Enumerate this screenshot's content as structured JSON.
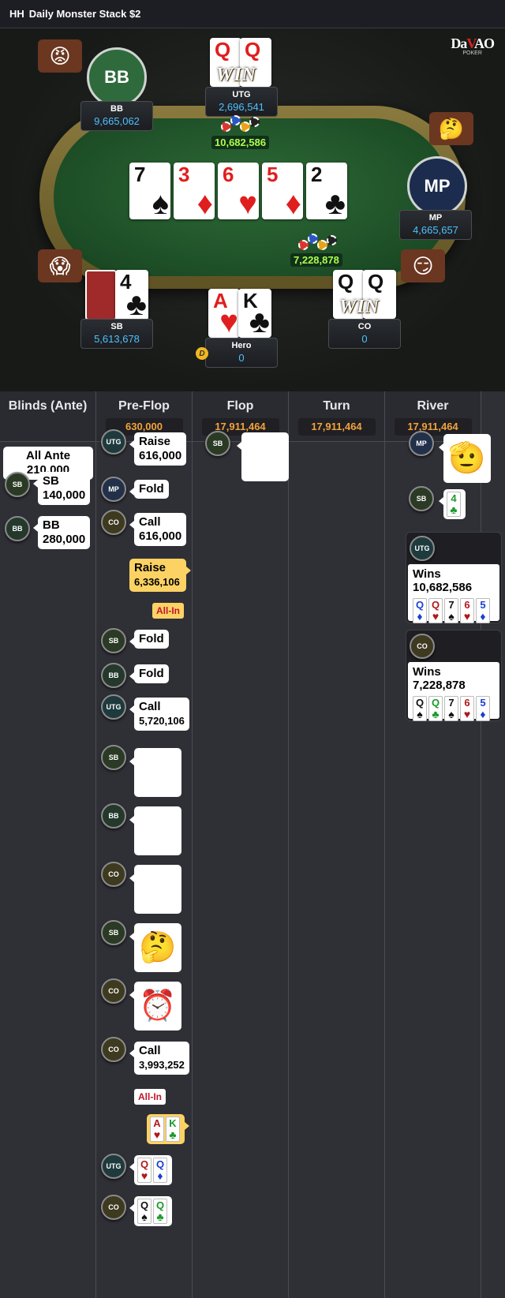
{
  "topbar": {
    "tag": "HH",
    "title": "Daily Monster Stack $2"
  },
  "logo": {
    "brand_a": "Da",
    "brand_b": "V",
    "brand_c": "AO",
    "sub": "POKER"
  },
  "seats": {
    "bb": {
      "avatar": "BB",
      "name": "BB",
      "stack": "9,665,062"
    },
    "utg": {
      "name": "UTG",
      "stack": "2,696,541",
      "cards": [
        "Q",
        "Q"
      ],
      "win": "WIN"
    },
    "mp": {
      "avatar": "MP",
      "name": "MP",
      "stack": "4,665,657"
    },
    "sb": {
      "name": "SB",
      "stack": "5,613,678",
      "card": "4"
    },
    "hero": {
      "name": "Hero",
      "stack": "0",
      "cards": [
        "A",
        "K"
      ],
      "dealer": "D"
    },
    "co": {
      "name": "CO",
      "stack": "0",
      "cards": [
        "Q",
        "Q"
      ],
      "win": "WIN"
    }
  },
  "board": [
    {
      "rank": "7",
      "suit": "♠",
      "color": "blk"
    },
    {
      "rank": "3",
      "suit": "♦",
      "color": "red"
    },
    {
      "rank": "6",
      "suit": "♥",
      "color": "red"
    },
    {
      "rank": "5",
      "suit": "♦",
      "color": "red"
    },
    {
      "rank": "2",
      "suit": "♣",
      "color": "blk"
    }
  ],
  "pots": {
    "main": "10,682,586",
    "side": "7,228,878"
  },
  "columns": [
    {
      "title": "Blinds (Ante)",
      "pot": ""
    },
    {
      "title": "Pre-Flop",
      "pot": "630,000"
    },
    {
      "title": "Flop",
      "pot": "17,911,464"
    },
    {
      "title": "Turn",
      "pot": "17,911,464"
    },
    {
      "title": "River",
      "pot": "17,911,464"
    }
  ],
  "blinds": {
    "ante_label": "All Ante",
    "ante_value": "210,000",
    "sb_badge": "SB",
    "sb_label": "SB",
    "sb_value": "140,000",
    "bb_badge": "BB",
    "bb_label": "BB",
    "bb_value": "280,000"
  },
  "preflop": {
    "utg_badge": "UTG",
    "utg_action": "Raise",
    "utg_amount": "616,000",
    "mp_badge": "MP",
    "mp_action": "Fold",
    "co_badge": "CO",
    "co_action": "Call",
    "co_amount": "616,000",
    "hero_action": "Raise",
    "hero_amount": "6,336,106",
    "hero_allin": "All-In",
    "sb_badge": "SB",
    "sb_action": "Fold",
    "bb_badge": "BB",
    "bb_action": "Fold",
    "utg2_badge": "UTG",
    "utg2_action": "Call",
    "utg2_amount": "5,720,106",
    "e1_badge": "SB",
    "e2_badge": "BB",
    "e3_badge": "CO",
    "e4_badge": "SB",
    "e5_badge": "CO",
    "co2_badge": "CO",
    "co2_action": "Call",
    "co2_amount": "3,993,252",
    "co2_allin": "All-In",
    "hero_cards": [
      {
        "r": "A",
        "s": "♥",
        "c": "s-hrt"
      },
      {
        "r": "K",
        "s": "♣",
        "c": "s-clb"
      }
    ],
    "utg_show_badge": "UTG",
    "utg_show": [
      {
        "r": "Q",
        "s": "♥",
        "c": "s-hrt"
      },
      {
        "r": "Q",
        "s": "♦",
        "c": "s-dia"
      }
    ],
    "co_show_badge": "CO",
    "co_show": [
      {
        "r": "Q",
        "s": "♠",
        "c": "s-spd"
      },
      {
        "r": "Q",
        "s": "♣",
        "c": "s-clb"
      }
    ]
  },
  "flop": {
    "sb_badge": "SB"
  },
  "river": {
    "mp_badge": "MP",
    "sb_badge": "SB",
    "sb_card": {
      "r": "4",
      "s": "♣",
      "c": "s-clb"
    },
    "utg_badge": "UTG",
    "utg_win": "Wins 10,682,586",
    "utg_hand": [
      {
        "r": "Q",
        "s": "♦",
        "c": "s-dia"
      },
      {
        "r": "Q",
        "s": "♥",
        "c": "s-hrt"
      },
      {
        "r": "7",
        "s": "♠",
        "c": "s-spd"
      },
      {
        "r": "6",
        "s": "♥",
        "c": "s-hrt"
      },
      {
        "r": "5",
        "s": "♦",
        "c": "s-dia"
      }
    ],
    "co_badge": "CO",
    "co_win": "Wins 7,228,878",
    "co_hand": [
      {
        "r": "Q",
        "s": "♠",
        "c": "s-spd"
      },
      {
        "r": "Q",
        "s": "♣",
        "c": "s-clb"
      },
      {
        "r": "7",
        "s": "♠",
        "c": "s-spd"
      },
      {
        "r": "6",
        "s": "♥",
        "c": "s-hrt"
      },
      {
        "r": "5",
        "s": "♦",
        "c": "s-dia"
      }
    ]
  },
  "icons": {
    "emote_scared": "😱",
    "emote_angry": "😡",
    "emote_smirk": "😏",
    "emote_thinking": "🤔",
    "emote_clock": "⏰",
    "emote_salute": "🫡"
  }
}
